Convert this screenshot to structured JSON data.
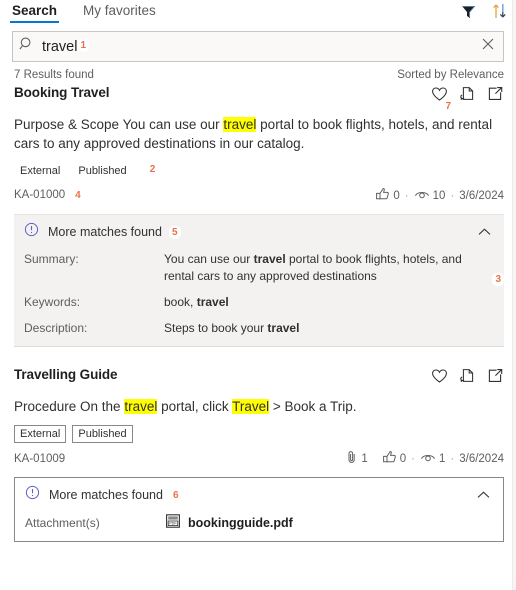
{
  "tabs": [
    {
      "label": "Search",
      "active": true
    },
    {
      "label": "My favorites",
      "active": false
    }
  ],
  "header_icons": {
    "filter": "filter-icon",
    "sort": "sort-icon"
  },
  "search": {
    "value": "travel",
    "placeholder": "Search",
    "marker": "1",
    "search_icon": "search-icon",
    "clear_icon": "close-icon"
  },
  "results_bar": {
    "count_text": "7 Results found",
    "sort_text": "Sorted by Relevance"
  },
  "results": [
    {
      "title": "Booking Travel",
      "snippet_pre": "Purpose & Scope You can use our ",
      "snippet_highlight": "travel",
      "snippet_post": " portal to book flights, hotels, and rental cars to any approved destinations in our catalog.",
      "badges": [
        "External",
        "Published"
      ],
      "badges_marker": "2",
      "badges_bordered": false,
      "ka_id": "KA-01000",
      "ka_marker": "4",
      "stats_marker": "3",
      "actions_marker": "7",
      "likes": "0",
      "views": "10",
      "date": "3/6/2024",
      "attachment_count": null,
      "actions": [
        "favorite-icon",
        "copy-link-icon",
        "open-in-new-icon"
      ],
      "panel": {
        "title": "More matches found",
        "marker": "5",
        "style": "shaded",
        "info_icon": "info-icon",
        "chevron_icon": "chevron-up-icon",
        "rows": [
          {
            "key": "Summary:",
            "pre": "You can use our ",
            "bold": "travel",
            "post": " portal to book flights, hotels, and rental cars to any approved destinations"
          },
          {
            "key": "Keywords:",
            "pre": "book, ",
            "bold": "travel",
            "post": ""
          },
          {
            "key": "Description:",
            "pre": "Steps to book your ",
            "bold": "travel",
            "post": ""
          }
        ]
      }
    },
    {
      "title": "Travelling Guide",
      "snippet_pre": "Procedure On the ",
      "snippet_highlight": "travel",
      "snippet_mid": " portal, click ",
      "snippet_highlight2": "Travel",
      "snippet_post": " > Book a Trip.",
      "badges": [
        "External",
        "Published"
      ],
      "badges_bordered": true,
      "ka_id": "KA-01009",
      "likes": "0",
      "views": "1",
      "date": "3/6/2024",
      "attachment_count": "1",
      "actions": [
        "favorite-icon",
        "copy-link-icon",
        "open-in-new-icon"
      ],
      "panel": {
        "title": "More matches found",
        "marker": "6",
        "style": "outlined",
        "info_icon": "info-icon",
        "chevron_icon": "chevron-up-icon",
        "attachment_label": "Attachment(s)",
        "attachment_file": "bookingguide.pdf",
        "attachment_icon": "pdf-file-icon"
      }
    }
  ],
  "colors": {
    "accent": "#0078d4",
    "highlight": "#ffff00",
    "marker": "#e8734a",
    "panel_bg": "#f3f2f1",
    "border": "#8a8886"
  }
}
